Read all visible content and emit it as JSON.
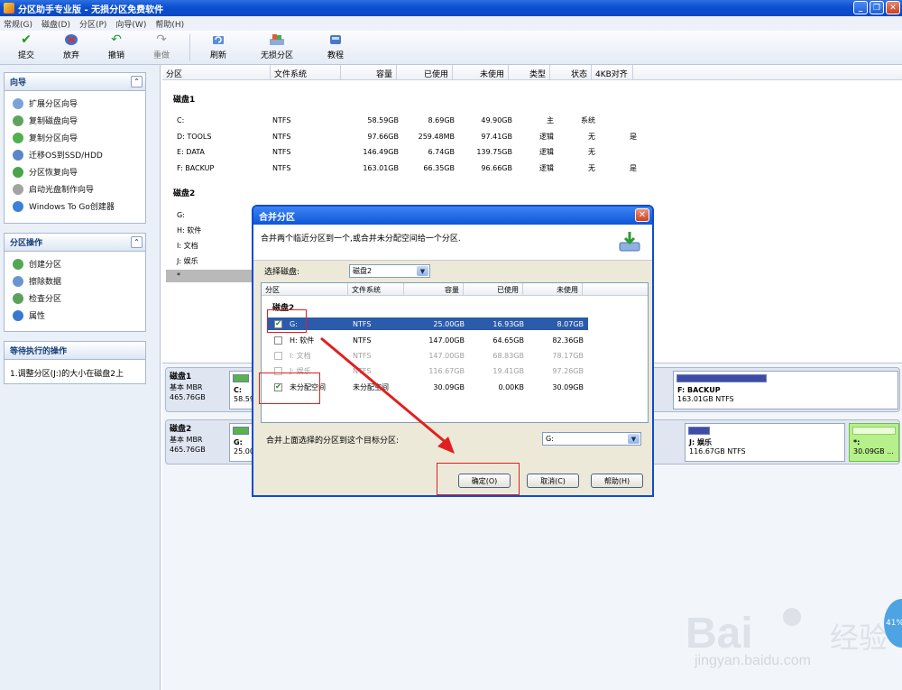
{
  "window": {
    "title": "分区助手专业版 - 无损分区免费软件",
    "btn_min": "_",
    "btn_restore": "❐",
    "btn_close": "✕"
  },
  "menu": [
    "常规(G)",
    "磁盘(D)",
    "分区(P)",
    "向导(W)",
    "帮助(H)"
  ],
  "toolbar": {
    "commit": "提交",
    "discard": "放弃",
    "undo": "撤销",
    "redo": "重做",
    "refresh": "刷新",
    "lossless": "无损分区",
    "tutorial": "教程"
  },
  "left": {
    "wizard": {
      "title": "向导",
      "items": [
        "扩展分区向导",
        "复制磁盘向导",
        "复制分区向导",
        "迁移OS到SSD/HDD",
        "分区恢复向导",
        "启动光盘制作向导",
        "Windows To Go创建器"
      ]
    },
    "ops": {
      "title": "分区操作",
      "items": [
        "创建分区",
        "擦除数据",
        "检查分区",
        "属性"
      ]
    },
    "pending": {
      "title": "等待执行的操作",
      "text": "1.调整分区(J:)的大小在磁盘2上"
    }
  },
  "table": {
    "headers": [
      "分区",
      "文件系统",
      "容量",
      "已使用",
      "未使用",
      "类型",
      "状态",
      "4KB对齐"
    ],
    "disk1": {
      "label": "磁盘1",
      "rows": [
        [
          "C:",
          "NTFS",
          "58.59GB",
          "8.69GB",
          "49.90GB",
          "主",
          "系统",
          ""
        ],
        [
          "D: TOOLS",
          "NTFS",
          "97.66GB",
          "259.48MB",
          "97.41GB",
          "逻辑",
          "无",
          "是"
        ],
        [
          "E: DATA",
          "NTFS",
          "146.49GB",
          "6.74GB",
          "139.75GB",
          "逻辑",
          "无",
          ""
        ],
        [
          "F: BACKUP",
          "NTFS",
          "163.01GB",
          "66.35GB",
          "96.66GB",
          "逻辑",
          "无",
          "是"
        ]
      ]
    },
    "disk2": {
      "label": "磁盘2",
      "rows": [
        "G:",
        "H: 软件",
        "I: 文档",
        "J: 娱乐",
        "*"
      ]
    }
  },
  "diskmap": {
    "disk1": {
      "name": "磁盘1",
      "type": "基本 MBR",
      "size": "465.76GB",
      "c_label": "C:",
      "c_size": "58.59",
      "f_label": "F: BACKUP",
      "f_size": "163.01GB NTFS"
    },
    "disk2": {
      "name": "磁盘2",
      "type": "基本 MBR",
      "size": "465.76GB",
      "g_label": "G:",
      "g_size": "25.00",
      "j_label": "J: 娱乐",
      "j_size": "116.67GB NTFS",
      "u_label": "*:",
      "u_size": "30.09GB ..."
    }
  },
  "dialog": {
    "title": "合并分区",
    "close": "✕",
    "desc": "合并两个临近分区到一个,或合并未分配空间给一个分区.",
    "select_disk_label": "选择磁盘:",
    "select_disk_value": "磁盘2",
    "headers": [
      "分区",
      "文件系统",
      "容量",
      "已使用",
      "未使用"
    ],
    "disk_label": "磁盘2",
    "rows": [
      {
        "check": "✔",
        "name": "G:",
        "fs": "NTFS",
        "cap": "25.00GB",
        "used": "16.93GB",
        "free": "8.07GB"
      },
      {
        "check": "",
        "name": "H: 软件",
        "fs": "NTFS",
        "cap": "147.00GB",
        "used": "64.65GB",
        "free": "82.36GB"
      },
      {
        "check": "",
        "name": "I: 文档",
        "fs": "NTFS",
        "cap": "147.00GB",
        "used": "68.83GB",
        "free": "78.17GB"
      },
      {
        "check": "",
        "name": "J: 娱乐",
        "fs": "NTFS",
        "cap": "116.67GB",
        "used": "19.41GB",
        "free": "97.26GB"
      },
      {
        "check": "✔",
        "name": "未分配空间",
        "fs": "未分配空间",
        "cap": "30.09GB",
        "used": "0.00KB",
        "free": "30.09GB"
      }
    ],
    "target_label": "合并上面选择的分区到这个目标分区:",
    "target_value": "G:",
    "ok": "确定(O)",
    "cancel": "取消(C)",
    "help": "帮助(H)"
  },
  "watermark": {
    "text": "Bai 经验",
    "url": "jingyan.baidu.com",
    "badge": "41%"
  },
  "colors": {
    "accent": "#0b4fd0",
    "selection": "#2b5bab",
    "annotation": "#e02020",
    "unallocated": "#b6f08a"
  }
}
